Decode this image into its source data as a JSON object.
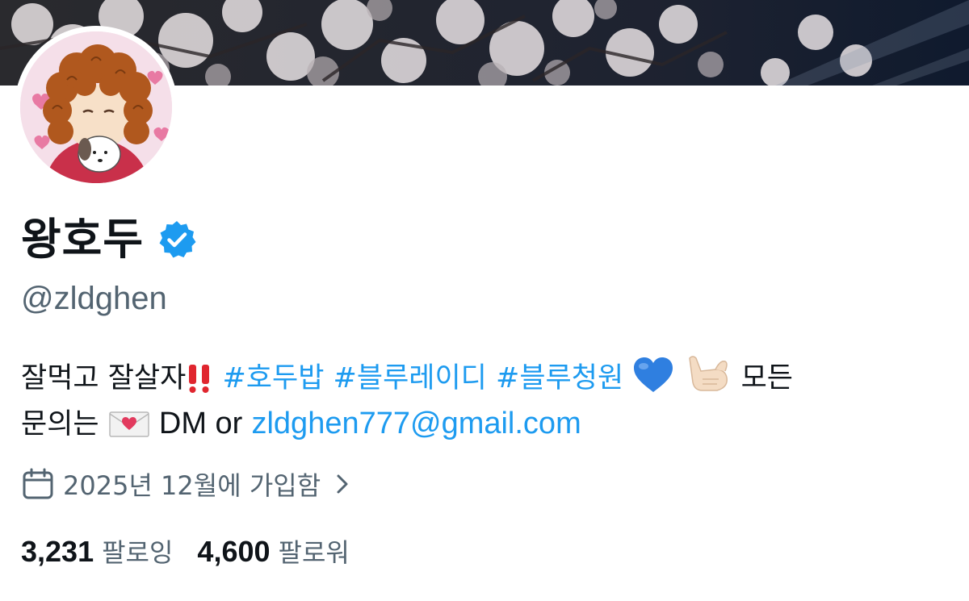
{
  "profile": {
    "display_name": "왕호두",
    "handle": "@zldghen",
    "verified_icon": "verified-badge-icon",
    "bio": {
      "text_1": "잘먹고 잘살자",
      "emoji_1": "double-exclamation",
      "hashtag_1": "#호두밥",
      "hashtag_2": "#블루레이디",
      "hashtag_3": "#블루청원",
      "emoji_2": "blue-heart",
      "emoji_3": "call-me-hand",
      "text_2": "모든",
      "text_3": "문의는",
      "emoji_4": "love-letter",
      "text_4": "DM or",
      "email": "zldghen777@gmail.com"
    },
    "joined": {
      "text": "2025년 12월에 가입함",
      "icon": "calendar-icon",
      "chevron_icon": "chevron-right-icon"
    },
    "following": {
      "count": "3,231",
      "label": "팔로잉"
    },
    "followers": {
      "count": "4,600",
      "label": "팔로워"
    }
  },
  "colors": {
    "accent": "#1d9bf0",
    "text_primary": "#0f1419",
    "text_secondary": "#536471",
    "verified": "#1d9bf0"
  }
}
